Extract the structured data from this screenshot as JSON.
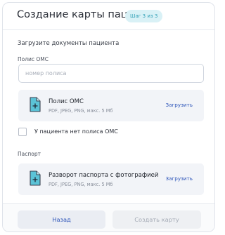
{
  "header": {
    "title": "Создание карты пациента",
    "step_badge": "Шаг 3 из 3"
  },
  "form": {
    "subtitle": "Загрузите документы пациента",
    "oms_label": "Полис ОМС",
    "oms_input": {
      "placeholder": "номер полиса",
      "value": ""
    },
    "oms_upload": {
      "title": "Полис ОМС",
      "hint": "PDF, JPEG, PNG, макс. 5 Мб",
      "action": "Загрузить",
      "icon": "document-plus-icon"
    },
    "no_oms_checkbox": {
      "label": "У пациента нет полиса ОМС",
      "checked": false
    },
    "passport_label": "Паспорт",
    "passport_upload": {
      "title": "Разворот паспорта с фотографией",
      "hint": "PDF, JPEG, PNG, макс. 5 Мб",
      "action": "Загрузить",
      "icon": "document-plus-icon"
    }
  },
  "footer": {
    "back_label": "Назад",
    "create_label": "Создать карту"
  },
  "colors": {
    "accent": "#2a52b8",
    "badge_bg": "#d9f1f6",
    "badge_text": "#2f9fb5",
    "icon_fill": "#5bc3d7",
    "upload_bg": "#f2f4f8"
  }
}
